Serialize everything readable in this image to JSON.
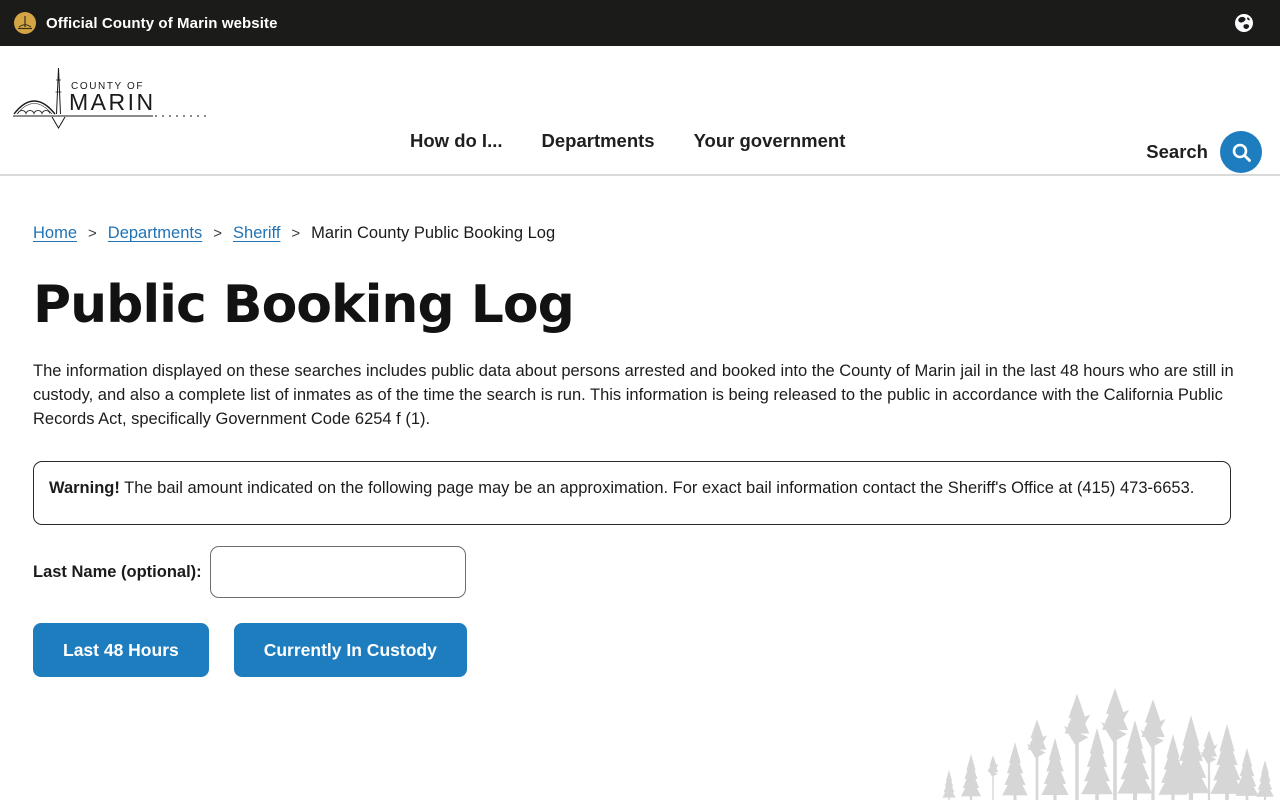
{
  "banner": {
    "text": "Official County of Marin website"
  },
  "header": {
    "logo_line1": "COUNTY OF",
    "logo_line2": "MARIN",
    "nav": [
      {
        "label": "How do I..."
      },
      {
        "label": "Departments"
      },
      {
        "label": "Your government"
      }
    ],
    "search_label": "Search"
  },
  "breadcrumb": {
    "separator": ">",
    "links": [
      "Home",
      "Departments",
      "Sheriff"
    ],
    "current": "Marin County Public Booking Log"
  },
  "page": {
    "title": "Public Booking Log",
    "intro": "The information displayed on these searches includes public data about persons arrested and booked into the County of Marin jail in the last 48 hours who are still in custody, and also a complete list of inmates as of the time the search is run. This information is being released to the public in accordance with the California Public Records Act, specifically Government Code 6254 f (1).",
    "warning_bold": "Warning!",
    "warning_text": " The bail amount indicated on the following page may be an approximation. For exact bail information contact the Sheriff's Office at (415) 473-6653.",
    "last_name_label": "Last Name (optional):",
    "last_name_value": "",
    "buttons": [
      {
        "label": "Last 48 Hours"
      },
      {
        "label": "Currently In Custody"
      }
    ]
  },
  "icons": {
    "banner_seal": "gold-county-seal",
    "language": "globe",
    "search": "magnifier"
  },
  "colors": {
    "banner_bg": "#1b1b1a",
    "accent_blue": "#1e7dbf",
    "link_blue": "#2173b4",
    "seal_gold": "#d3a544",
    "forest_gray": "#d6d6d6"
  }
}
